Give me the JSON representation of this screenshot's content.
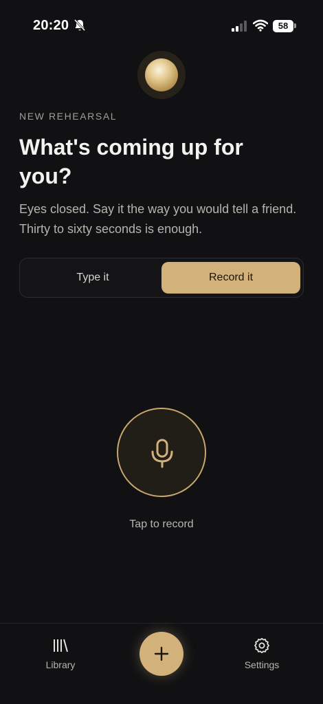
{
  "status_bar": {
    "time": "20:20",
    "battery": "58",
    "icons": [
      "bell-slash-icon",
      "cellular-signal-icon",
      "wifi-icon",
      "battery-icon"
    ]
  },
  "header": {
    "eyebrow": "NEW REHEARSAL",
    "title": "What's coming up for you?",
    "subtitle": "Eyes closed. Say it the way you would tell a friend. Thirty to sixty seconds is enough."
  },
  "mode_toggle": {
    "options": [
      {
        "label": "Type it",
        "selected": false
      },
      {
        "label": "Record it",
        "selected": true
      }
    ]
  },
  "recorder": {
    "icon": "microphone-icon",
    "hint": "Tap to record"
  },
  "bottom_nav": {
    "library_label": "Library",
    "settings_label": "Settings",
    "fab_icon": "plus-icon"
  },
  "colors": {
    "background": "#111113",
    "accent": "#d2b27a",
    "text_primary": "#f4f2ee",
    "text_muted": "#b7b4ae"
  }
}
